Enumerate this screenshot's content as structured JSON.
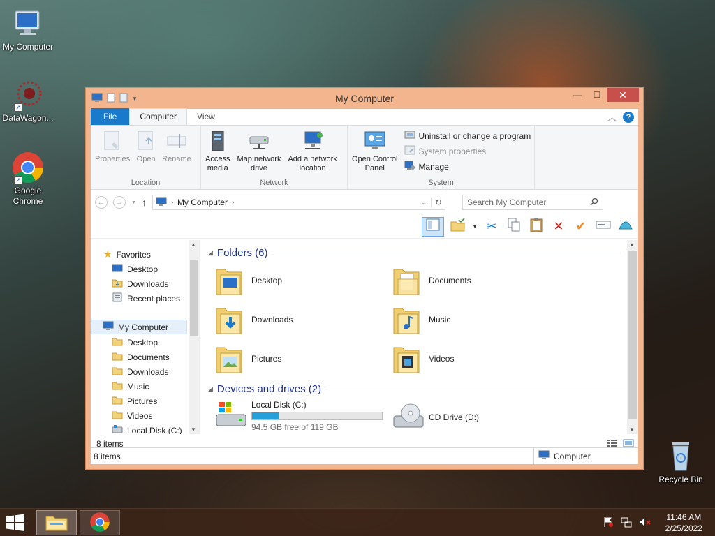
{
  "desktop": {
    "icons": [
      {
        "label": "My Computer"
      },
      {
        "label": "DataWagon..."
      },
      {
        "label": "Google\nChrome"
      },
      {
        "label": "Recycle Bin"
      }
    ]
  },
  "window": {
    "title": "My Computer",
    "tabs": [
      {
        "label": "File"
      },
      {
        "label": "Computer"
      },
      {
        "label": "View"
      }
    ],
    "ribbon": {
      "location": {
        "label": "Location",
        "buttons": [
          "Properties",
          "Open",
          "Rename"
        ]
      },
      "network": {
        "label": "Network",
        "access_media": "Access\nmedia",
        "map_drive": "Map network\ndrive",
        "add_location": "Add a network\nlocation"
      },
      "system": {
        "label": "System",
        "open_control_panel": "Open Control\nPanel",
        "uninstall": "Uninstall or change a program",
        "system_properties": "System properties",
        "manage": "Manage"
      }
    },
    "address": {
      "path": "My Computer",
      "search_placeholder": "Search My Computer"
    },
    "nav": {
      "favorites": "Favorites",
      "fav_items": [
        "Desktop",
        "Downloads",
        "Recent places"
      ],
      "computer": "My Computer",
      "computer_items": [
        "Desktop",
        "Documents",
        "Downloads",
        "Music",
        "Pictures",
        "Videos",
        "Local Disk (C:)"
      ]
    },
    "content": {
      "folders_header": "Folders (6)",
      "folders": [
        "Desktop",
        "Documents",
        "Downloads",
        "Music",
        "Pictures",
        "Videos"
      ],
      "devices_header": "Devices and drives (2)",
      "drives": [
        {
          "name": "Local Disk (C:)",
          "free_text": "94.5 GB free of 119 GB",
          "used_fraction": 0.206
        },
        {
          "name": "CD Drive (D:)"
        }
      ]
    },
    "item_count": "8 items",
    "status_left": "8 items",
    "status_right": "Computer"
  },
  "taskbar": {
    "time": "11:46 AM",
    "date": "2/25/2022"
  },
  "colors": {
    "window_frame": "#f2b58e",
    "accent": "#1979ca",
    "progress": "#26a0da",
    "close_button": "#c7504c"
  }
}
